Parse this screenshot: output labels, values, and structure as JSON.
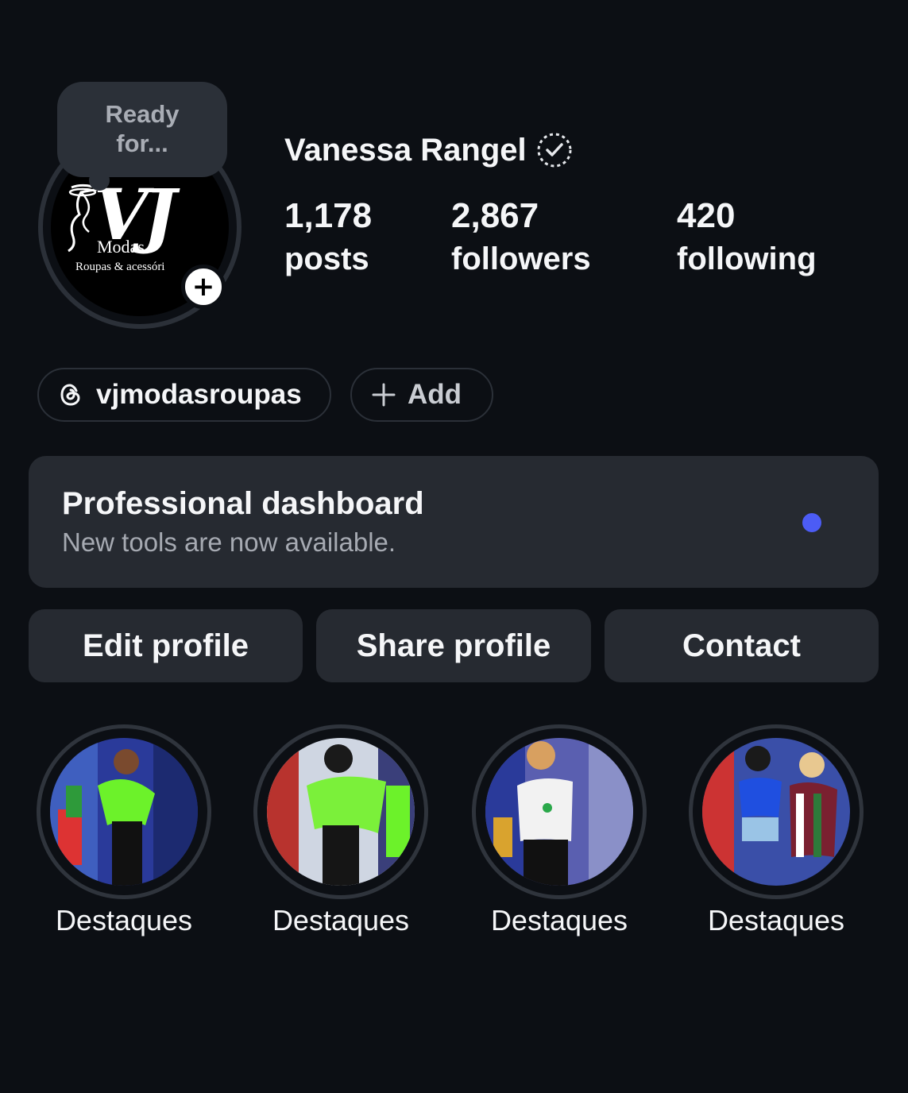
{
  "note": {
    "text": "Ready for..."
  },
  "profile": {
    "name": "Vanessa Rangel",
    "logo": {
      "mark": "VJ",
      "line1": "Modas",
      "line2": "Roupas & acessóri"
    }
  },
  "stats": [
    {
      "value": "1,178",
      "label": "posts"
    },
    {
      "value": "2,867",
      "label": "followers"
    },
    {
      "value": "420",
      "label": "following"
    }
  ],
  "links": {
    "threads_handle": "vjmodasroupas",
    "add_label": "Add"
  },
  "dashboard": {
    "title": "Professional dashboard",
    "subtitle": "New tools are now available.",
    "indicator_color": "#4c5cf5"
  },
  "actions": {
    "edit": "Edit profile",
    "share": "Share profile",
    "contact": "Contact"
  },
  "highlights": [
    {
      "label": "Destaques",
      "accent": "#6cf22a"
    },
    {
      "label": "Destaques",
      "accent": "#7bf03a"
    },
    {
      "label": "Destaques",
      "accent": "#ffffff"
    },
    {
      "label": "Destaques",
      "accent": "#1f4fe0"
    }
  ],
  "icons": {
    "verified": "verified-badge-icon",
    "threads": "threads-icon",
    "add": "plus-icon",
    "story_add": "plus-icon"
  }
}
